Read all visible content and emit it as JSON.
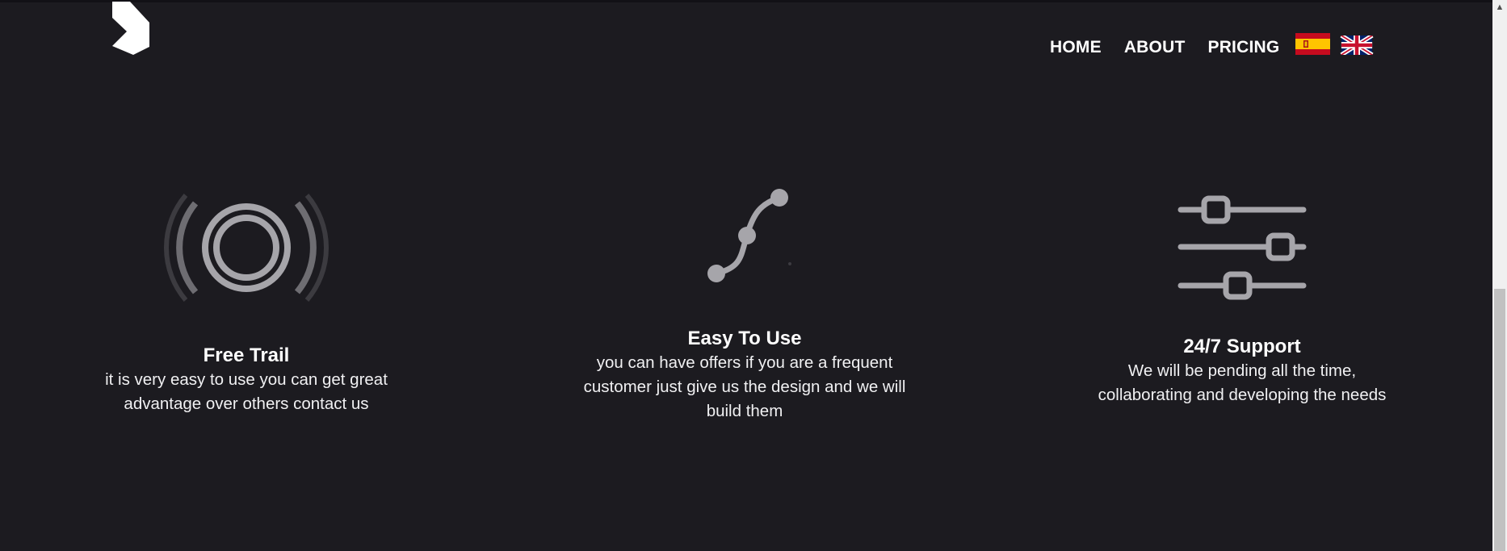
{
  "nav": {
    "items": [
      {
        "label": "HOME"
      },
      {
        "label": "ABOUT"
      },
      {
        "label": "PRICING"
      }
    ],
    "flags": [
      {
        "icon": "spain-flag-icon"
      },
      {
        "icon": "uk-flag-icon"
      }
    ]
  },
  "features": [
    {
      "icon": "broadcast-signal-icon",
      "title": "Free Trail",
      "desc_lines": [
        "it is very easy to use you can get great",
        "advantage over others contact us"
      ]
    },
    {
      "icon": "curve-nodes-icon",
      "title": "Easy To Use",
      "desc_lines": [
        "you can have offers if you are a frequent",
        "customer just give us the design and we will",
        "build them"
      ]
    },
    {
      "icon": "sliders-icon",
      "title": "24/7 Support",
      "desc_lines": [
        "We will be pending all the time,",
        "collaborating and developing the needs"
      ]
    }
  ],
  "colors": {
    "background": "#1c1b20",
    "icon_gray": "#a6a5aa",
    "text": "#ffffff"
  }
}
